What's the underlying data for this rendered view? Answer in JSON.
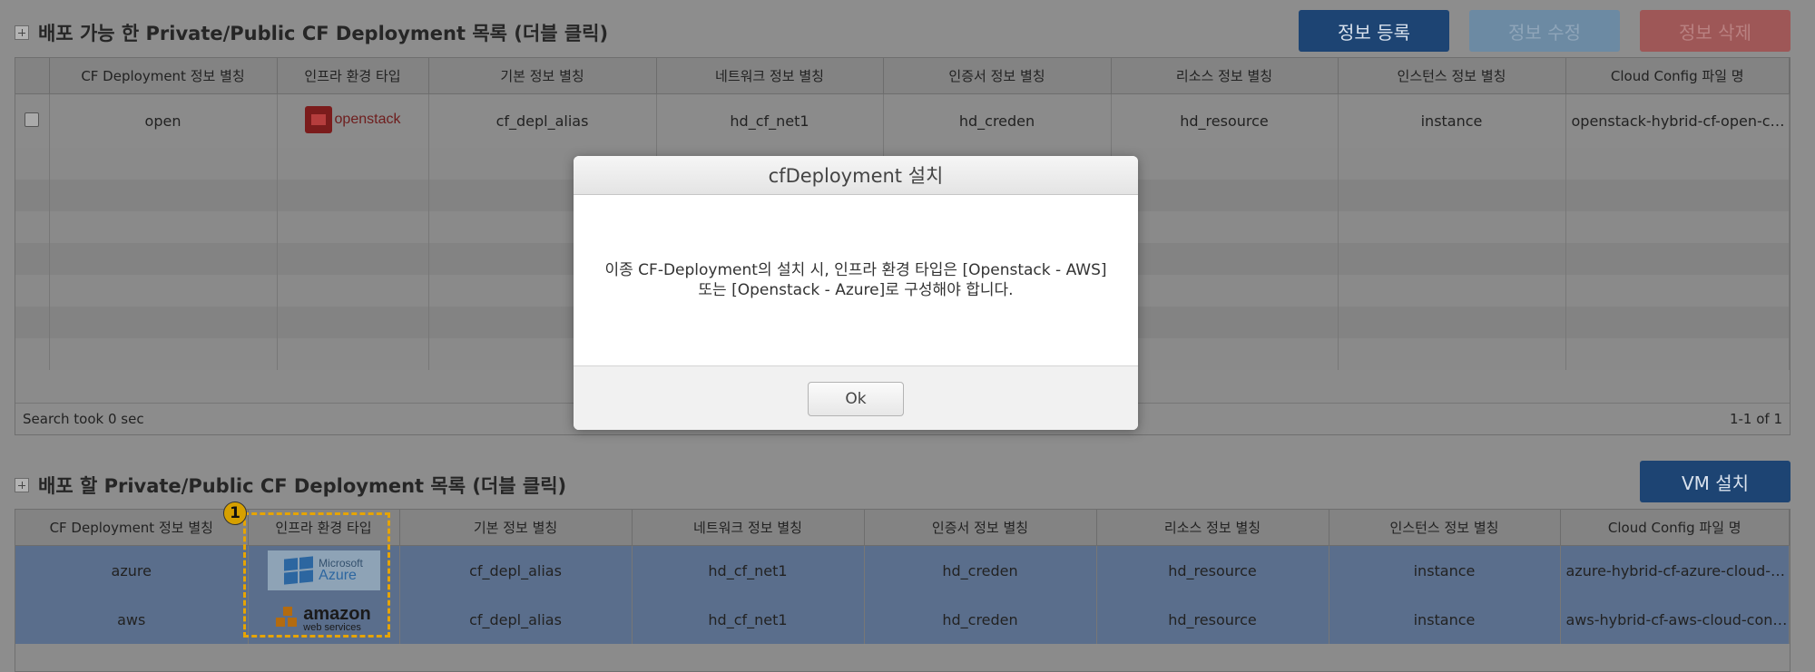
{
  "top_section": {
    "title": "배포 가능 한 Private/Public CF Deployment 목록 (더블 클릭)",
    "buttons": {
      "register": "정보 등록",
      "edit": "정보 수정",
      "delete": "정보 삭제"
    },
    "columns": [
      "CF Deployment 정보 별칭",
      "인프라 환경 타입",
      "기본 정보 별칭",
      "네트워크 정보 별칭",
      "인증서 정보 별칭",
      "리소스 정보 별칭",
      "인스턴스 정보 별칭",
      "Cloud Config 파일 명"
    ],
    "rows": [
      {
        "alias": "open",
        "infra_logo_text": "openstack",
        "basic": "cf_depl_alias",
        "network": "hd_cf_net1",
        "cert": "hd_creden",
        "resource": "hd_resource",
        "instance": "instance",
        "config": "openstack-hybrid-cf-open-clo..."
      }
    ],
    "footer": {
      "status": "Search took 0 sec",
      "paging": "1-1 of 1"
    }
  },
  "bottom_section": {
    "title": "배포 할 Private/Public CF Deployment 목록 (더블 클릭)",
    "vm_button": "VM 설치",
    "columns": [
      "CF Deployment 정보 별칭",
      "인프라 환경 타입",
      "기본 정보 별칭",
      "네트워크 정보 별칭",
      "인증서 정보 별칭",
      "리소스 정보 별칭",
      "인스턴스 정보 별칭",
      "Cloud Config 파일 명"
    ],
    "rows": [
      {
        "alias": "azure",
        "infra_logo": "microsoft-azure-logo",
        "logo_text_1": "Microsoft",
        "logo_text_2": "Azure",
        "basic": "cf_depl_alias",
        "network": "hd_cf_net1",
        "cert": "hd_creden",
        "resource": "hd_resource",
        "instance": "instance",
        "config": "azure-hybrid-cf-azure-cloud-c..."
      },
      {
        "alias": "aws",
        "infra_logo": "amazon-web-services-logo",
        "logo_text_1": "amazon",
        "logo_text_2": "web services",
        "basic": "cf_depl_alias",
        "network": "hd_cf_net1",
        "cert": "hd_creden",
        "resource": "hd_resource",
        "instance": "instance",
        "config": "aws-hybrid-cf-aws-cloud-conf..."
      }
    ],
    "annotation_number": "1"
  },
  "modal": {
    "title": "cfDeployment 설치",
    "message": "이종 CF-Deployment의 설치 시, 인프라 환경 타입은 [Openstack - AWS] 또는 [Openstack - Azure]로 구성해야 합니다.",
    "ok_label": "Ok"
  },
  "colors": {
    "primary": "#1d4473",
    "highlight": "#e6a400",
    "selected_row": "#5a6e8c"
  }
}
